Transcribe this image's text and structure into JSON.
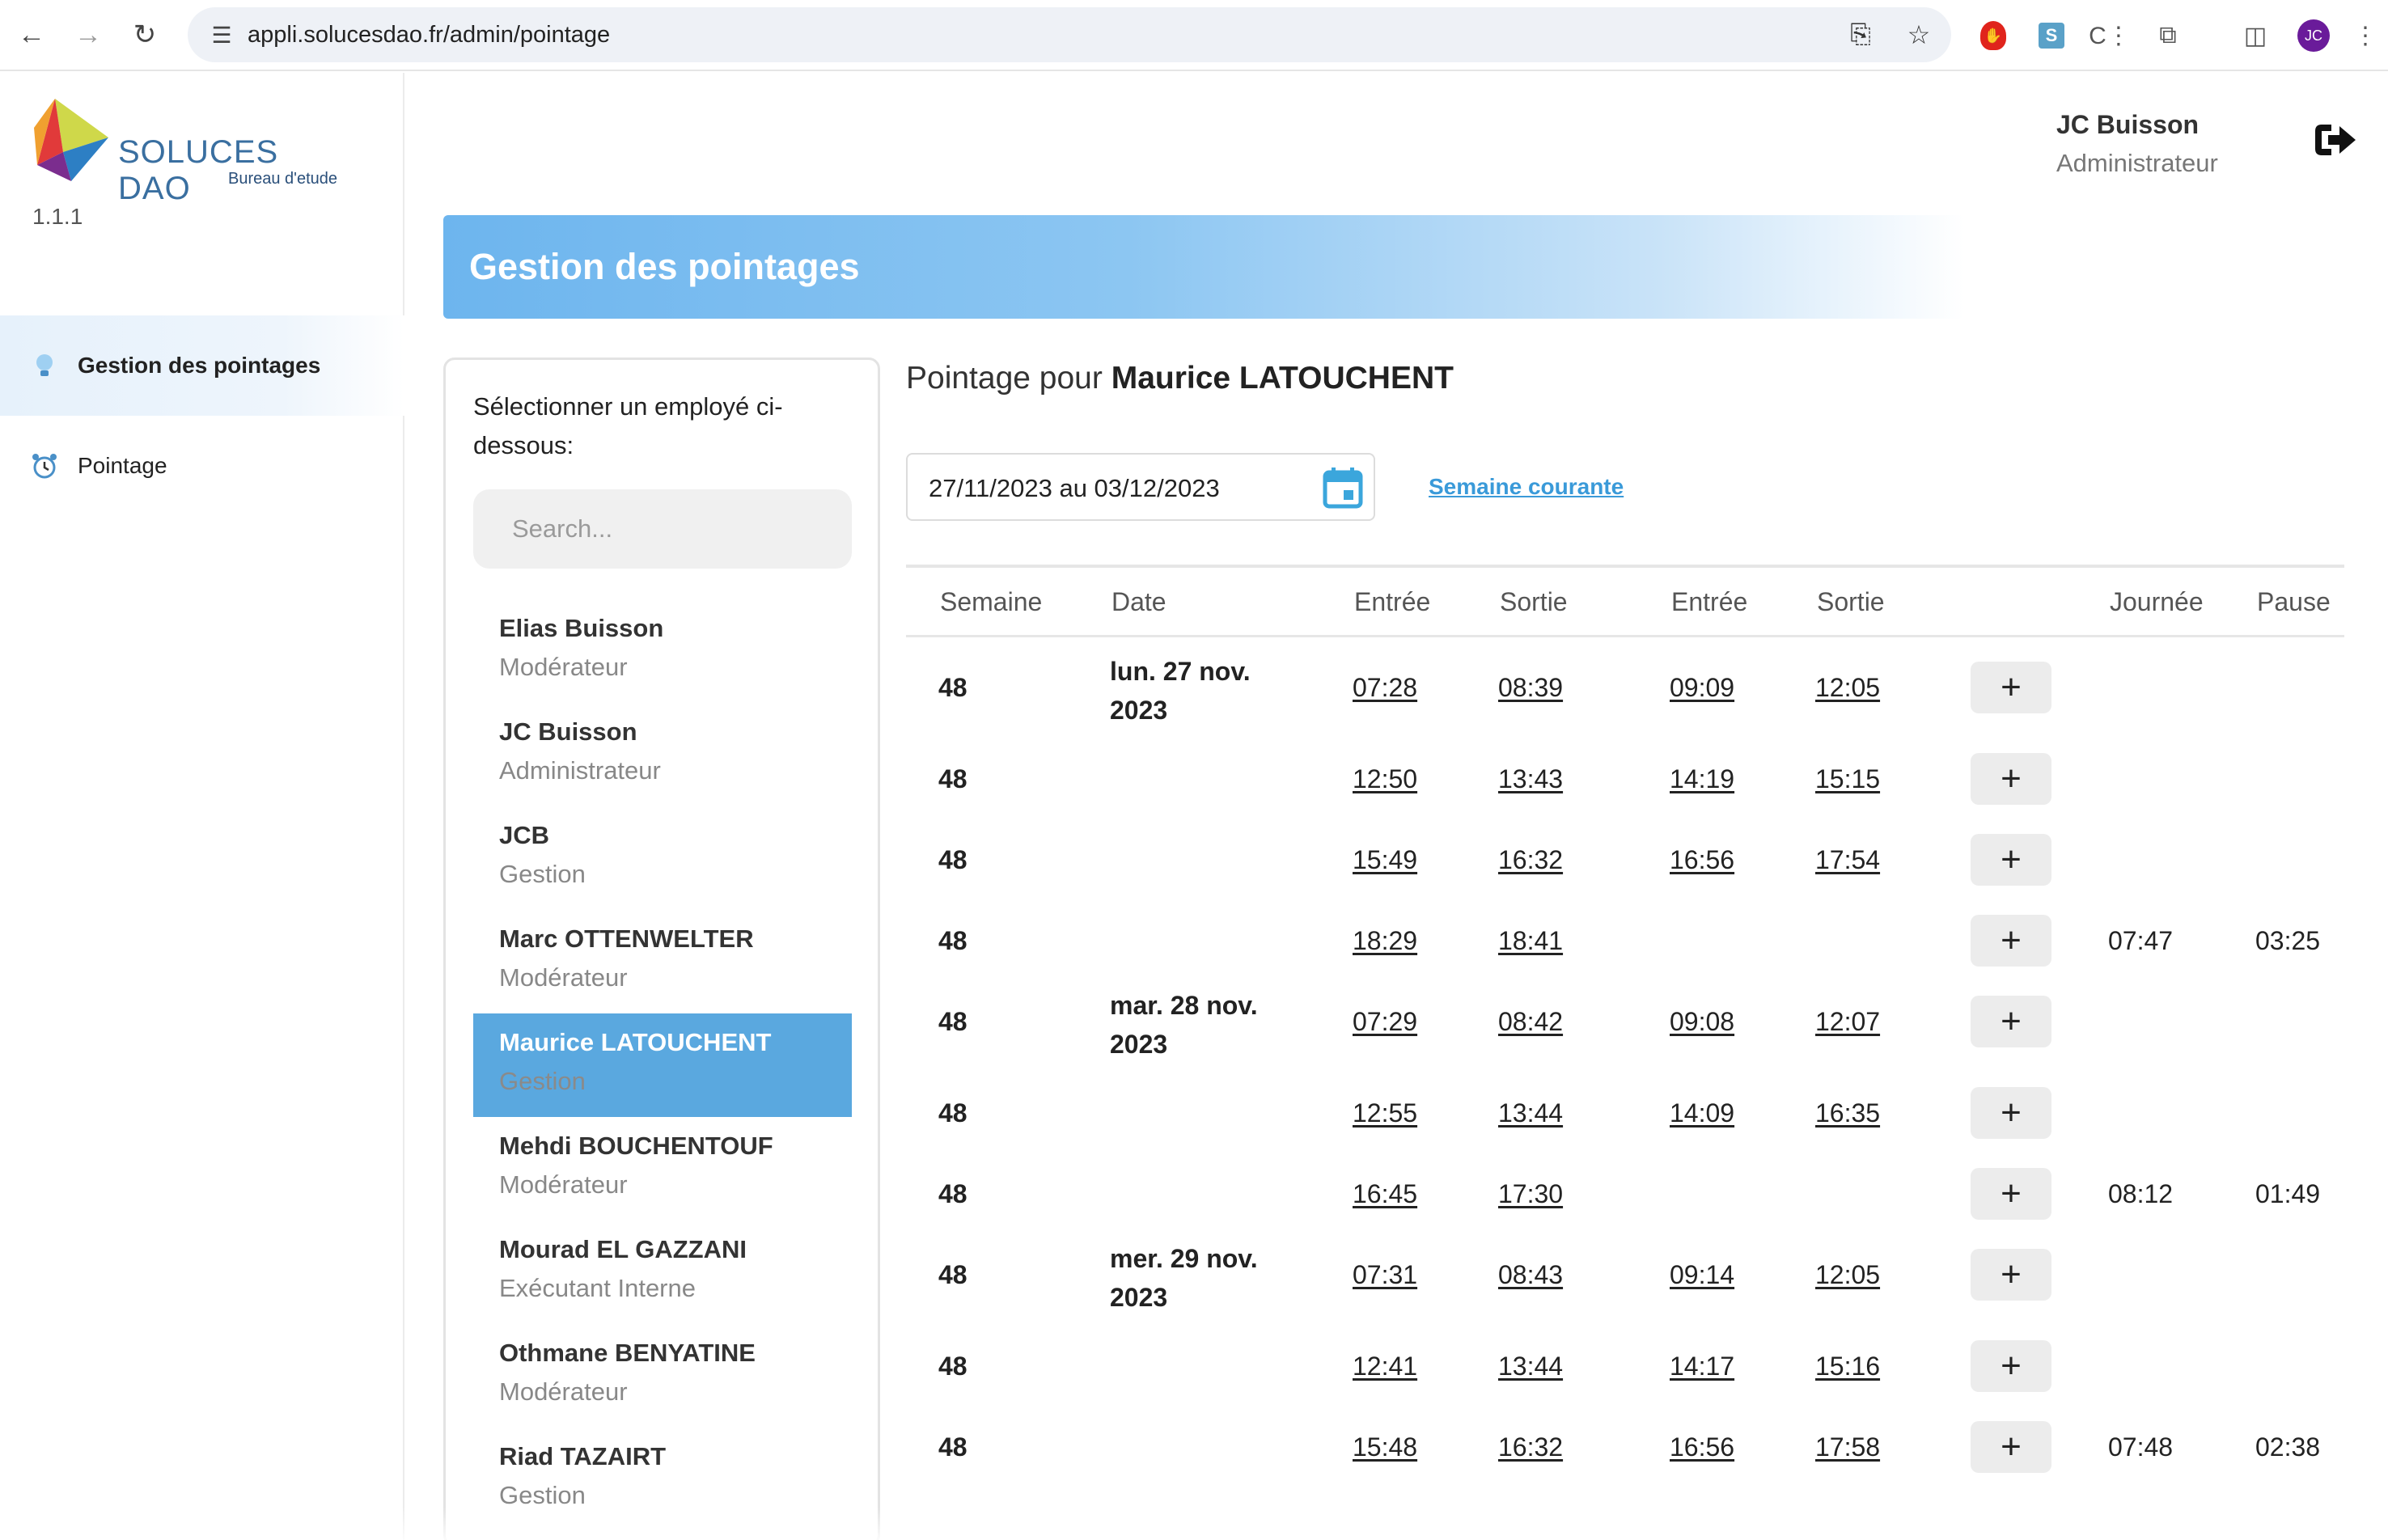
{
  "browser": {
    "url": "appli.solucesdao.fr/admin/pointage",
    "profile_initials": "JC"
  },
  "app": {
    "logo_title": "SOLUCES DAO",
    "logo_subtitle": "Bureau d'etude",
    "version": "1.1.1"
  },
  "sidebar": {
    "items": [
      {
        "label": "Gestion des pointages",
        "icon": "lightbulb-icon",
        "active": true
      },
      {
        "label": "Pointage",
        "icon": "alarm-clock-icon",
        "active": false
      }
    ]
  },
  "user": {
    "name": "JC Buisson",
    "role": "Administrateur"
  },
  "page": {
    "title": "Gestion des pointages"
  },
  "employees": {
    "prompt": "Sélectionner un employé ci-dessous:",
    "search_placeholder": "Search...",
    "list": [
      {
        "name": "Elias Buisson",
        "role": "Modérateur"
      },
      {
        "name": "JC Buisson",
        "role": "Administrateur"
      },
      {
        "name": "JCB",
        "role": "Gestion"
      },
      {
        "name": "Marc OTTENWELTER",
        "role": "Modérateur"
      },
      {
        "name": "Maurice LATOUCHENT",
        "role": "Gestion",
        "selected": true
      },
      {
        "name": "Mehdi BOUCHENTOUF",
        "role": "Modérateur"
      },
      {
        "name": "Mourad EL GAZZANI",
        "role": "Exécutant Interne"
      },
      {
        "name": "Othmane BENYATINE",
        "role": "Modérateur"
      },
      {
        "name": "Riad TAZAIRT",
        "role": "Gestion"
      }
    ]
  },
  "pointage": {
    "title_prefix": "Pointage pour",
    "employee": "Maurice LATOUCHENT",
    "date_range": "27/11/2023 au 03/12/2023",
    "current_week_link": "Semaine courante",
    "columns": [
      "Semaine",
      "Date",
      "Entrée",
      "Sortie",
      "Entrée",
      "Sortie",
      "Journée",
      "Pause"
    ],
    "add_label": "+",
    "rows": [
      {
        "week": "48",
        "date": "lun. 27 nov. 2023",
        "in1": "07:28",
        "out1": "08:39",
        "in2": "09:09",
        "out2": "12:05",
        "day": "",
        "pause": ""
      },
      {
        "week": "48",
        "date": "",
        "in1": "12:50",
        "out1": "13:43",
        "in2": "14:19",
        "out2": "15:15",
        "day": "",
        "pause": ""
      },
      {
        "week": "48",
        "date": "",
        "in1": "15:49",
        "out1": "16:32",
        "in2": "16:56",
        "out2": "17:54",
        "day": "",
        "pause": ""
      },
      {
        "week": "48",
        "date": "",
        "in1": "18:29",
        "out1": "18:41",
        "in2": "",
        "out2": "",
        "day": "07:47",
        "pause": "03:25"
      },
      {
        "week": "48",
        "date": "mar. 28 nov. 2023",
        "in1": "07:29",
        "out1": "08:42",
        "in2": "09:08",
        "out2": "12:07",
        "day": "",
        "pause": ""
      },
      {
        "week": "48",
        "date": "",
        "in1": "12:55",
        "out1": "13:44",
        "in2": "14:09",
        "out2": "16:35",
        "day": "",
        "pause": ""
      },
      {
        "week": "48",
        "date": "",
        "in1": "16:45",
        "out1": "17:30",
        "in2": "",
        "out2": "",
        "day": "08:12",
        "pause": "01:49"
      },
      {
        "week": "48",
        "date": "mer. 29 nov. 2023",
        "in1": "07:31",
        "out1": "08:43",
        "in2": "09:14",
        "out2": "12:05",
        "day": "",
        "pause": ""
      },
      {
        "week": "48",
        "date": "",
        "in1": "12:41",
        "out1": "13:44",
        "in2": "14:17",
        "out2": "15:16",
        "day": "",
        "pause": ""
      },
      {
        "week": "48",
        "date": "",
        "in1": "15:48",
        "out1": "16:32",
        "in2": "16:56",
        "out2": "17:58",
        "day": "07:48",
        "pause": "02:38"
      }
    ]
  }
}
